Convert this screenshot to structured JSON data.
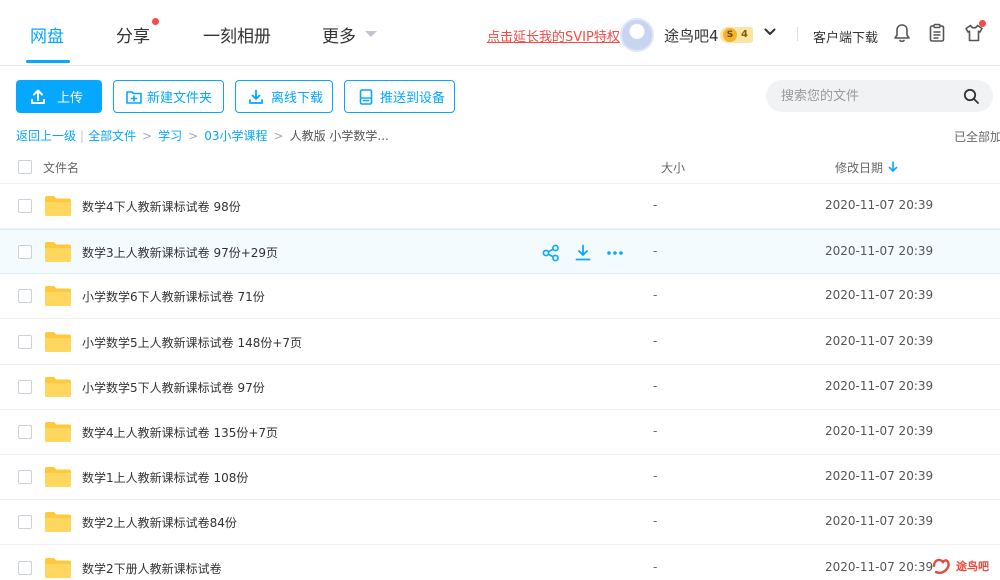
{
  "nav": {
    "tabs": [
      {
        "label": "网盘",
        "active": true
      },
      {
        "label": "分享",
        "badge": true
      },
      {
        "label": "一刻相册"
      },
      {
        "label": "更多"
      }
    ]
  },
  "header": {
    "svip_link": "点击延长我的SVIP特权",
    "username": "途鸟吧4",
    "vip_badge": {
      "s": "S",
      "level": "4"
    },
    "client_download": "客户端下载"
  },
  "toolbar": {
    "upload": "上传",
    "new_folder": "新建文件夹",
    "offline_download": "离线下载",
    "push_device": "推送到设备",
    "search_placeholder": "搜索您的文件"
  },
  "breadcrumb": {
    "back": "返回上一级",
    "items": [
      "全部文件",
      "学习",
      "03小学课程"
    ],
    "current": "人教版 小学数学...",
    "loaded": "已全部加载"
  },
  "table": {
    "headers": {
      "name": "文件名",
      "size": "大小",
      "modified": "修改日期"
    },
    "rows": [
      {
        "name": "数学4下人教新课标试卷 98份",
        "size": "-",
        "date": "2020-11-07 20:39"
      },
      {
        "name": "数学3上人教新课标试卷 97份+29页",
        "size": "-",
        "date": "2020-11-07 20:39"
      },
      {
        "name": "小学数学6下人教新课标试卷 71份",
        "size": "-",
        "date": "2020-11-07 20:39"
      },
      {
        "name": "小学数学5上人教新课标试卷 148份+7页",
        "size": "-",
        "date": "2020-11-07 20:39"
      },
      {
        "name": "小学数学5下人教新课标试卷 97份",
        "size": "-",
        "date": "2020-11-07 20:39"
      },
      {
        "name": "数学4上人教新课标试卷 135份+7页",
        "size": "-",
        "date": "2020-11-07 20:39"
      },
      {
        "name": "数学1上人教新课标试卷 108份",
        "size": "-",
        "date": "2020-11-07 20:39"
      },
      {
        "name": "数学2上人教新课标试卷84份",
        "size": "-",
        "date": "2020-11-07 20:39"
      },
      {
        "name": "数学2下册人教新课标试卷",
        "size": "-",
        "date": "2020-11-07 20:39"
      }
    ]
  },
  "watermark": "途鸟吧",
  "colors": {
    "accent": "#06a7ff",
    "alert": "#f54a45",
    "folder": "#ffc83d"
  }
}
